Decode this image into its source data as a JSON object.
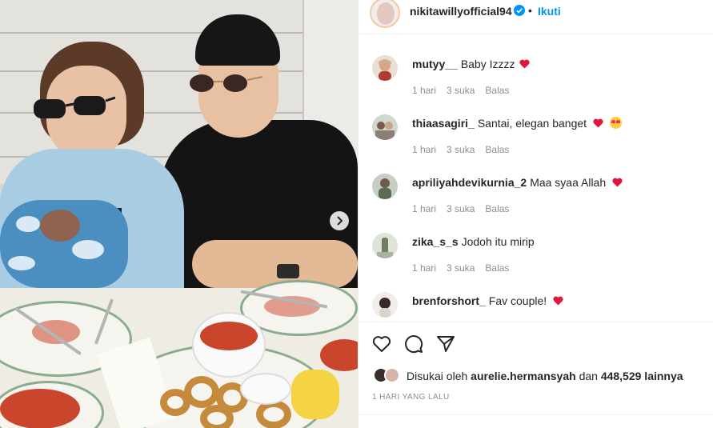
{
  "post": {
    "username": "nikitawillyofficial94",
    "separator": "•",
    "follow_label": "Ikuti",
    "verified_color": "#0095f6"
  },
  "comments": [
    {
      "user": "mutyy__",
      "text": "Baby Izzzz",
      "time": "1 hari",
      "likes": "3 suka",
      "reply": "Balas",
      "hearts": 1,
      "emoji": false
    },
    {
      "user": "thiaasagiri_",
      "text": "Santai, elegan banget",
      "time": "1 hari",
      "likes": "3 suka",
      "reply": "Balas",
      "hearts": 1,
      "emoji": true
    },
    {
      "user": "apriliyahdevikurnia_2",
      "text": "Maa syaa Allah",
      "time": "1 hari",
      "likes": "3 suka",
      "reply": "Balas",
      "hearts": 1,
      "emoji": false
    },
    {
      "user": "zika_s_s",
      "text": "Jodoh itu mirip",
      "time": "1 hari",
      "likes": "3 suka",
      "reply": "Balas",
      "hearts": 0,
      "emoji": false
    },
    {
      "user": "brenforshort_",
      "text": "Fav couple!",
      "time": "",
      "likes": "",
      "reply": "",
      "hearts": 1,
      "emoji": false
    }
  ],
  "likes": {
    "prefix": "Disukai oleh",
    "user": "aurelie.hermansyah",
    "middle": "dan",
    "count": "448,529 lainnya"
  },
  "date": "1 HARI YANG LALU",
  "colors": {
    "heart": "#ed4956",
    "follow": "#0095f6",
    "meta": "#8e8e8e"
  },
  "icons": {
    "like": "heart-outline-icon",
    "comment": "speech-bubble-icon",
    "share": "paper-plane-icon",
    "next": "chevron-right-icon"
  }
}
